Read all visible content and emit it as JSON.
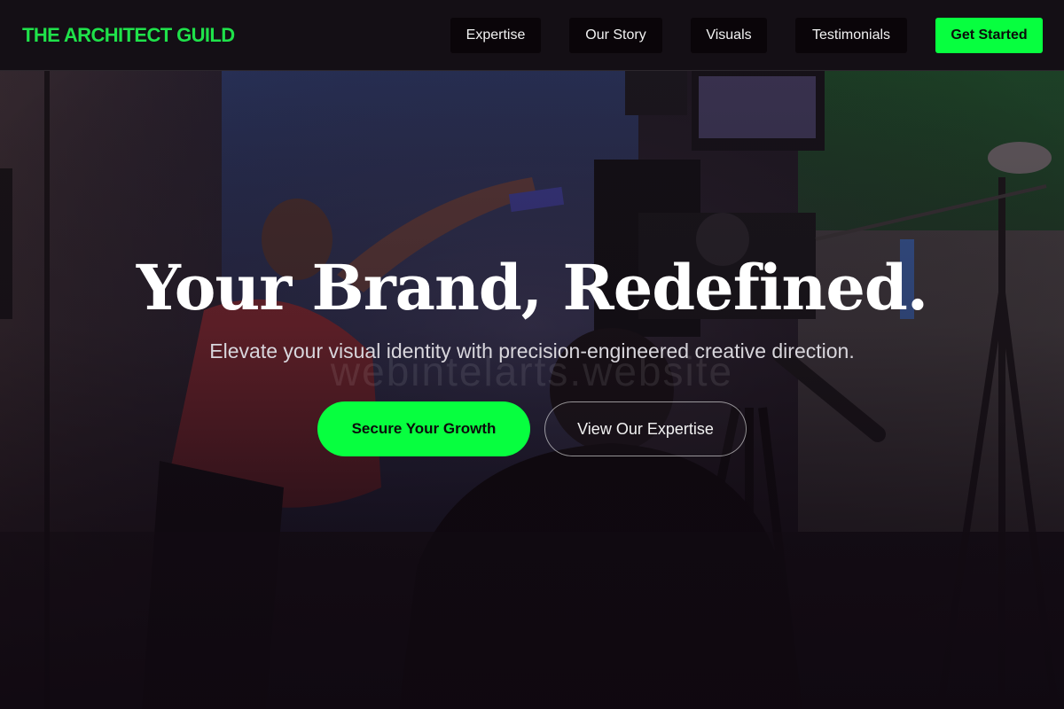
{
  "brand": {
    "name": "THE ARCHITECT GUILD",
    "accent_color": "#07ff3f"
  },
  "nav": {
    "items": [
      {
        "label": "Expertise"
      },
      {
        "label": "Our Story"
      },
      {
        "label": "Visuals"
      },
      {
        "label": "Testimonials"
      }
    ],
    "cta_label": "Get Started"
  },
  "hero": {
    "headline": "Your Brand, Redefined.",
    "subtitle": "Elevate your visual identity with precision-engineered creative direction.",
    "watermark": "webintelarts.website",
    "primary_button": "Secure Your Growth",
    "secondary_button": "View Our Expertise",
    "background_image": "film-studio-photo"
  }
}
